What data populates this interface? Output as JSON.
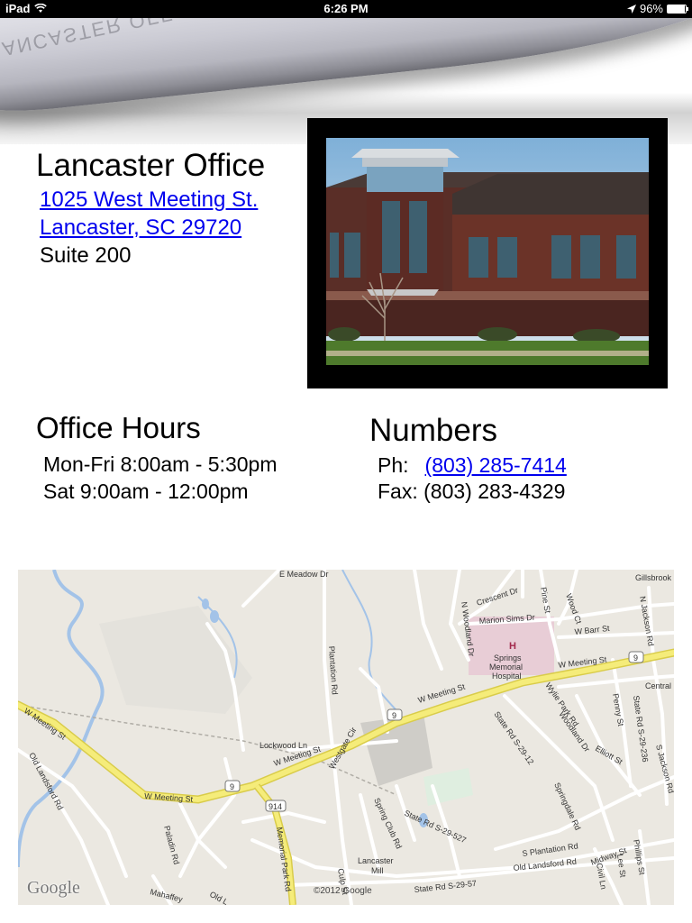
{
  "status_bar": {
    "device": "iPad",
    "time": "6:26 PM",
    "battery": "96%",
    "battery_level": 0.96
  },
  "page_curl": {
    "reversed_text": "LANCASTER OFF"
  },
  "office": {
    "title": "Lancaster Office",
    "address_line1": "1025 West Meeting St.",
    "address_line2": "Lancaster, SC 29720",
    "suite": "Suite 200"
  },
  "hours": {
    "title": "Office Hours",
    "weekday": "Mon-Fri 8:00am - 5:30pm",
    "saturday": "Sat 9:00am - 12:00pm"
  },
  "numbers": {
    "title": "Numbers",
    "phone_label": "Ph:",
    "phone": "(803) 285-7414",
    "fax_label": "Fax:",
    "fax": "(803) 283-4329"
  },
  "map": {
    "labels": {
      "e_meadow": "E Meadow Dr",
      "crescent": "Crescent Dr",
      "wood_ct": "Wood Ct",
      "pine": "Pine St",
      "gillsbrook": "Gillsbrook",
      "n_jackson": "N Jackson Rd",
      "marion_sims": "Marion Sims Dr",
      "w_barr": "W Barr St",
      "n_woodland": "N Woodland Dr",
      "plantation": "Plantation Rd",
      "w_meeting_1": "W Meeting St",
      "w_meeting_2": "W Meeting St",
      "w_meeting_3": "W Meeting St",
      "w_meeting_4": "W Meeting St",
      "w_meeting_5": "W Meeting St",
      "hospital_h": "H",
      "hospital_1": "Springs",
      "hospital_2": "Memorial",
      "hospital_3": "Hospital",
      "route_9": "9",
      "route_914": "914",
      "central": "Central",
      "wylie_park": "Wylie Park Rd",
      "state_rd_s29_12": "State Rd S-29-12",
      "woodland_dr": "Woodland Dr",
      "penny": "Penny St",
      "state_rd_s29_236": "State Rd S-29-236",
      "s_jackson": "S Jackson Rd",
      "elliott": "Elliott St",
      "lockwood": "Lockwood Ln",
      "old_landsford": "Old Landsford Rd",
      "west_gate": "Westgate Cir",
      "spring_club": "Spring Club Rd",
      "state_rd_s29_527": "State Rd S-29-527",
      "springdale": "Springdale Rd",
      "paladin": "Paladin Rd",
      "memorial_park": "Memorial Park Rd",
      "s_plantation": "S Plantation Rd",
      "midway": "Midway St",
      "phillips": "Phillips St",
      "lancaster_mill_1": "Lancaster",
      "lancaster_mill_2": "Mill",
      "old_landsford_2": "Old Landsford Rd",
      "state_rd_s29_57": "State Rd S-29-57",
      "civil": "Civil Ln",
      "lee": "Lee St",
      "culp": "Culp St",
      "mahaffey": "Mahaffey",
      "old_l": "Old L"
    },
    "logo": "Google",
    "copyright": "©2012 Google"
  },
  "colors": {
    "link": "#0000ee",
    "map_bg": "#ebe8e1",
    "highway": "#f5ec7a",
    "water": "#a3c3e8",
    "hospital_zone": "#e8cdd6"
  }
}
